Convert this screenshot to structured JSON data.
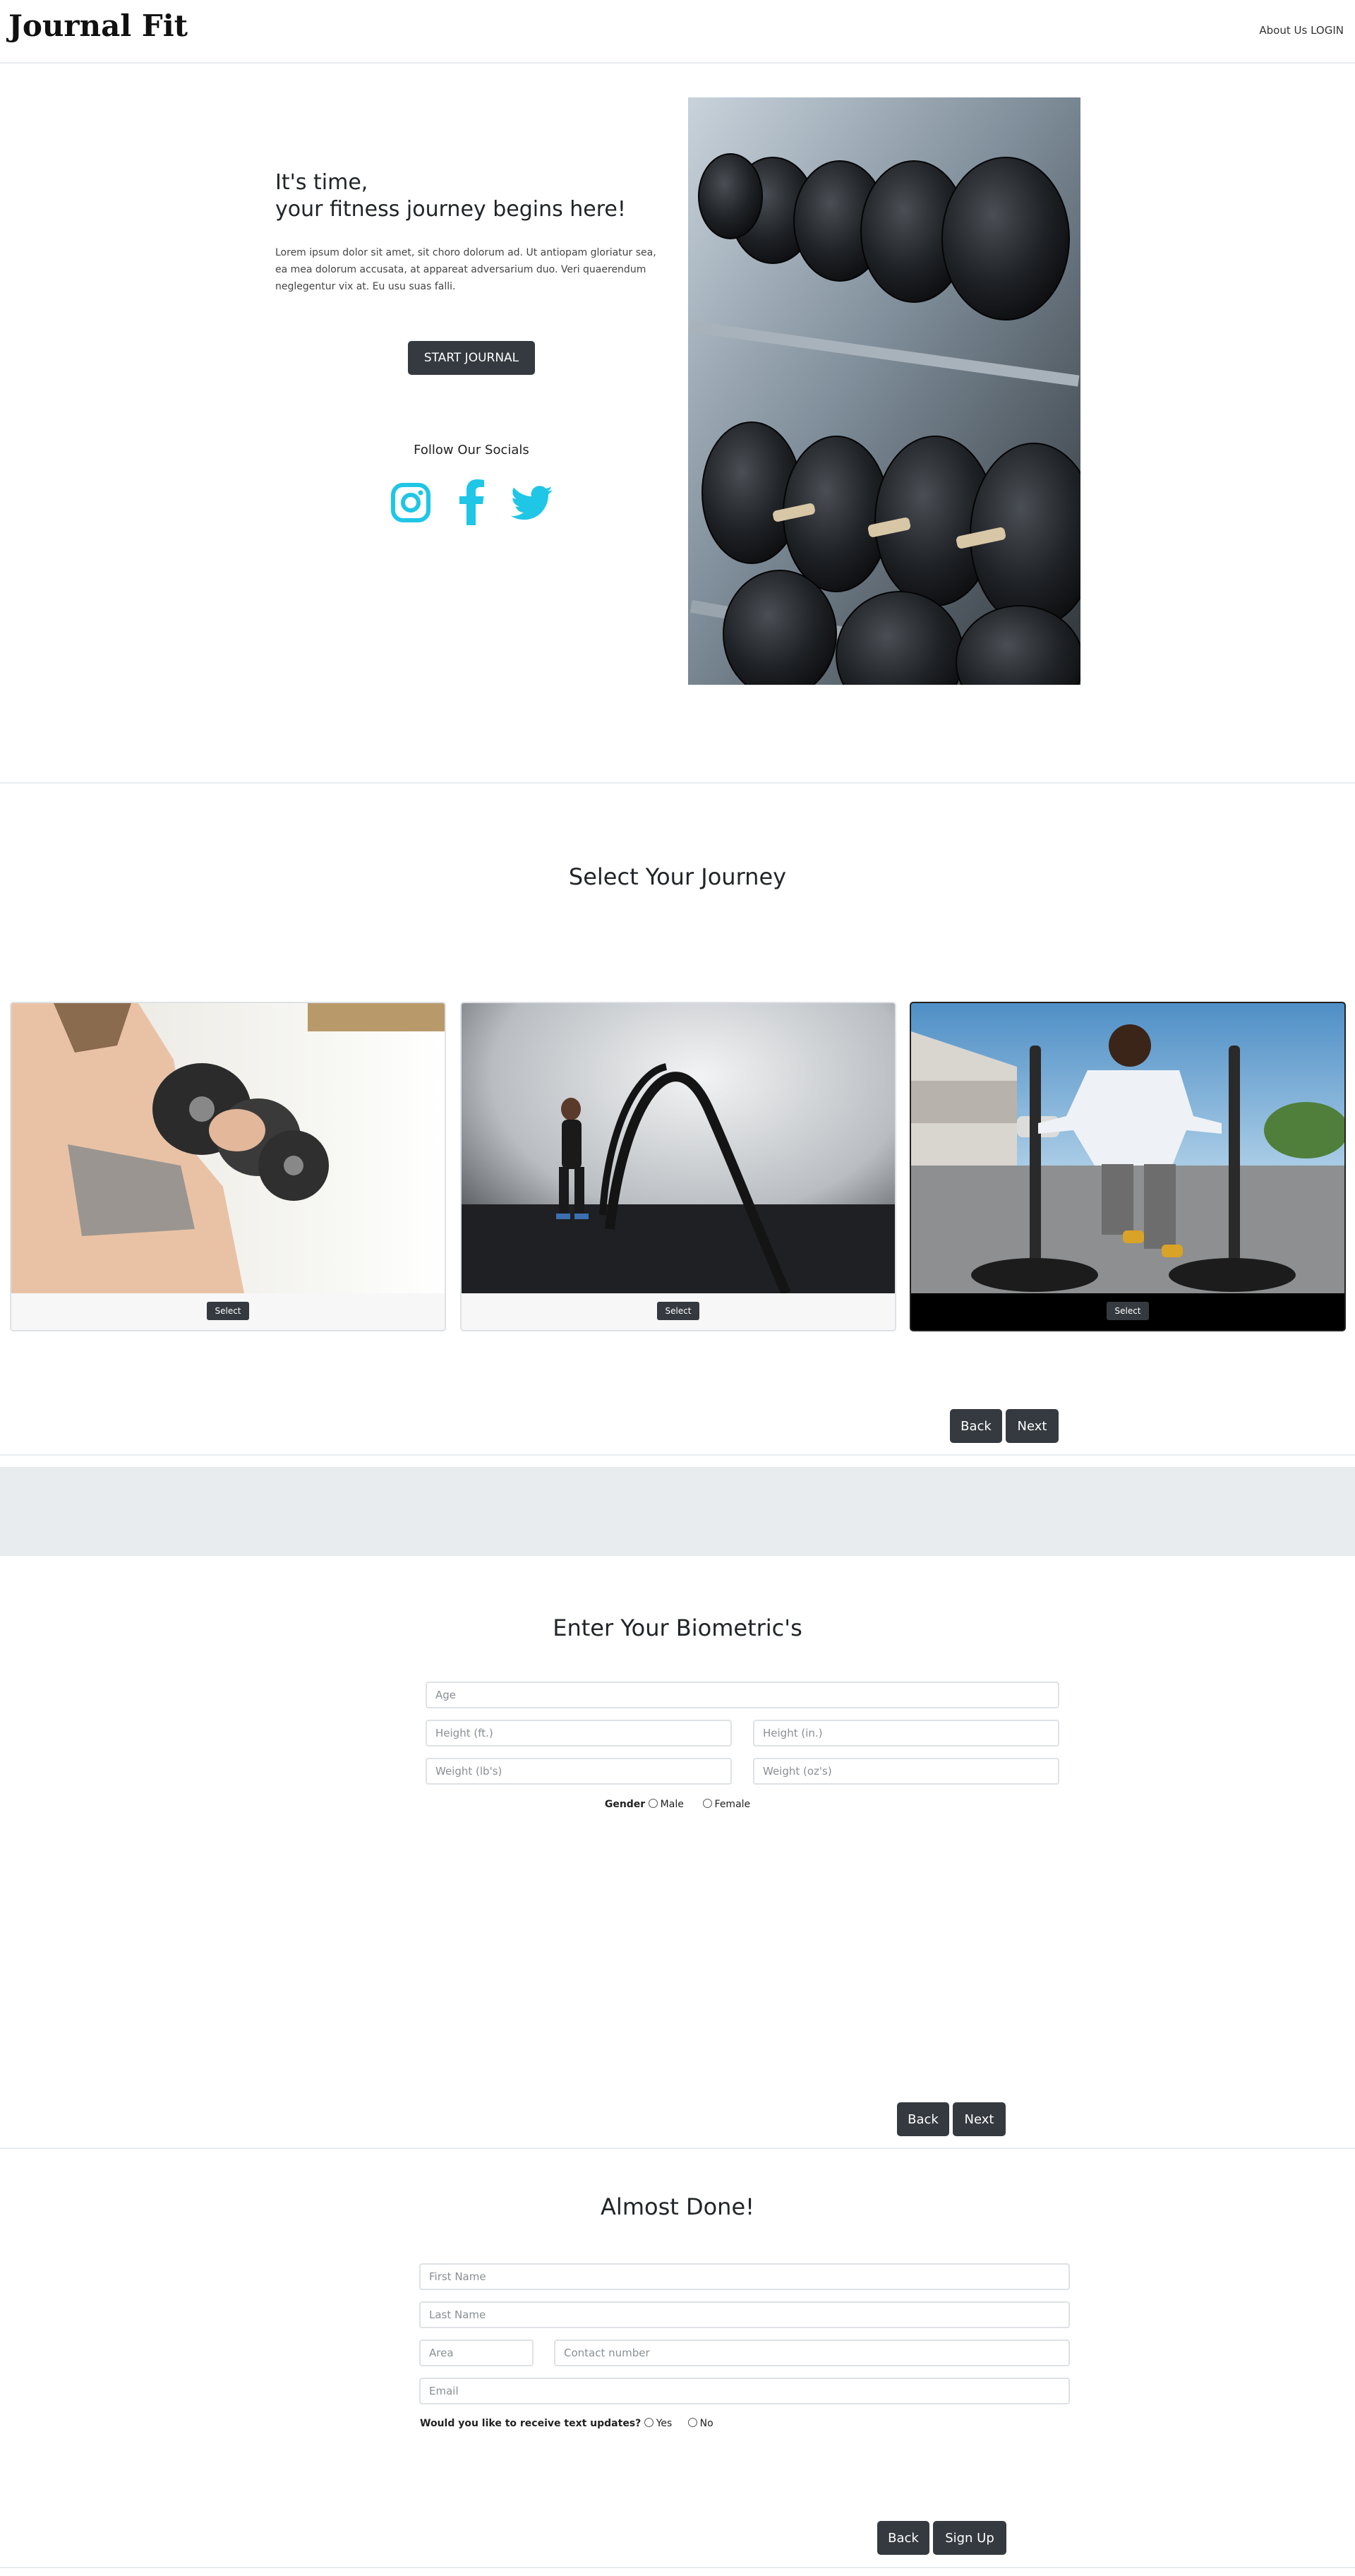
{
  "nav": {
    "brand": "Journal Fit",
    "about_label": "About Us",
    "login_label": "LOGIN"
  },
  "hero": {
    "title_line1": "It's time,",
    "title_line2": "your fitness journey begins here!",
    "body": "Lorem ipsum dolor sit amet, sit choro dolorum ad. Ut antiopam gloriatur sea, ea mea dolorum accusata, at appareat adversarium duo. Veri quaerendum neglegentur vix at. Eu usu suas falli.",
    "cta_label": "START JOURNAL",
    "socials_heading": "Follow Our Socials",
    "social_icons": [
      "instagram-icon",
      "facebook-icon",
      "twitter-icon"
    ],
    "social_color": "#1fc6e6"
  },
  "journey": {
    "title": "Select Your Journey",
    "cards": [
      {
        "select_label": "Select",
        "photo": "woman-lifting-dumbbells"
      },
      {
        "select_label": "Select",
        "photo": "woman-with-battle-ropes"
      },
      {
        "select_label": "Select",
        "photo": "man-pushing-sled"
      }
    ],
    "back_label": "Back",
    "next_label": "Next"
  },
  "biometrics": {
    "title": "Enter Your Biometric's",
    "age_placeholder": "Age",
    "height_ft_placeholder": "Height (ft.)",
    "height_in_placeholder": "Height (in.)",
    "weight_lb_placeholder": "Weight (lb's)",
    "weight_oz_placeholder": "Weight (oz's)",
    "gender_label": "Gender",
    "male_label": "Male",
    "female_label": "Female",
    "back_label": "Back",
    "next_label": "Next"
  },
  "signup": {
    "title": "Almost Done!",
    "first_name_placeholder": "First Name",
    "last_name_placeholder": "Last Name",
    "area_placeholder": "Area",
    "contact_placeholder": "Contact number",
    "email_placeholder": "Email",
    "updates_question": "Would you like to receive text updates?",
    "yes_label": "Yes",
    "no_label": "No",
    "back_label": "Back",
    "signup_label": "Sign Up"
  },
  "colors": {
    "accent_dark": "#343a40",
    "social_cyan": "#1fc6e6",
    "band_gray": "#e9ecef"
  }
}
